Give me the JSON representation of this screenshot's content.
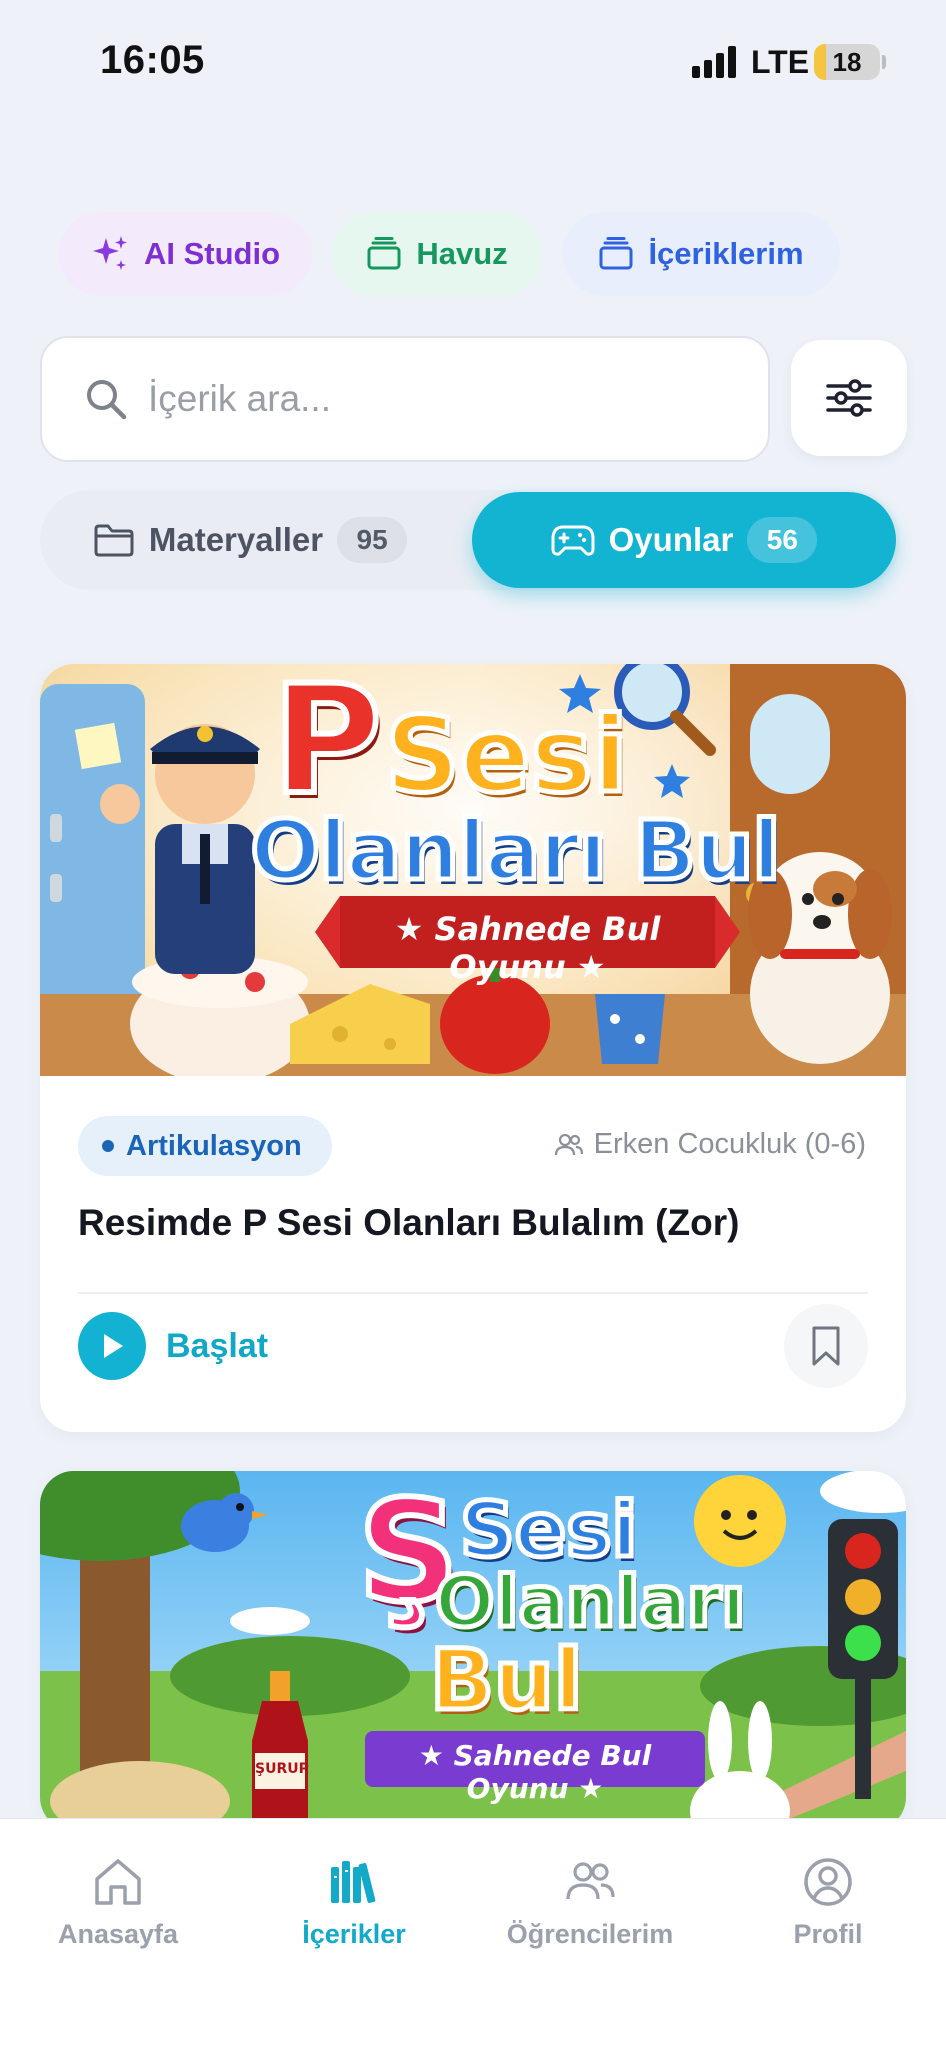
{
  "status": {
    "time": "16:05",
    "network": "LTE",
    "battery": "18",
    "battery_level": 0.18
  },
  "pills": [
    {
      "label": "AI Studio",
      "icon": "sparkle-icon"
    },
    {
      "label": "Havuz",
      "icon": "stack-icon"
    },
    {
      "label": "İçeriklerim",
      "icon": "stack-icon"
    }
  ],
  "search": {
    "placeholder": "İçerik ara...",
    "value": ""
  },
  "segments": {
    "materials": {
      "label": "Materyaller",
      "count": "95"
    },
    "games": {
      "label": "Oyunlar",
      "count": "56"
    }
  },
  "cards": [
    {
      "image_title_a": "P",
      "image_title_b": "Sesi",
      "image_title_c": "Olanları Bul",
      "image_subtitle": "★ Sahnede Bul Oyunu ★",
      "tag": "Artikulasyon",
      "audience": "Erken Cocukluk (0-6)",
      "title": "Resimde P Sesi Olanları Bulalım (Zor)",
      "start_label": "Başlat"
    },
    {
      "image_title_a": "Ş",
      "image_title_b": "Sesi",
      "image_title_c": "Olanları",
      "image_title_d": "Bul",
      "image_subtitle": "★ Sahnede Bul Oyunu ★",
      "image_label": "ŞURUP"
    }
  ],
  "nav": [
    {
      "label": "Anasayfa",
      "icon": "home-icon"
    },
    {
      "label": "İçerikler",
      "icon": "library-icon"
    },
    {
      "label": "Öğrencilerim",
      "icon": "users-icon"
    },
    {
      "label": "Profil",
      "icon": "profile-icon"
    }
  ],
  "colors": {
    "accent": "#13b3d2",
    "ai": "#7e2fd2",
    "pool": "#16975f",
    "mine": "#2f62e0"
  }
}
